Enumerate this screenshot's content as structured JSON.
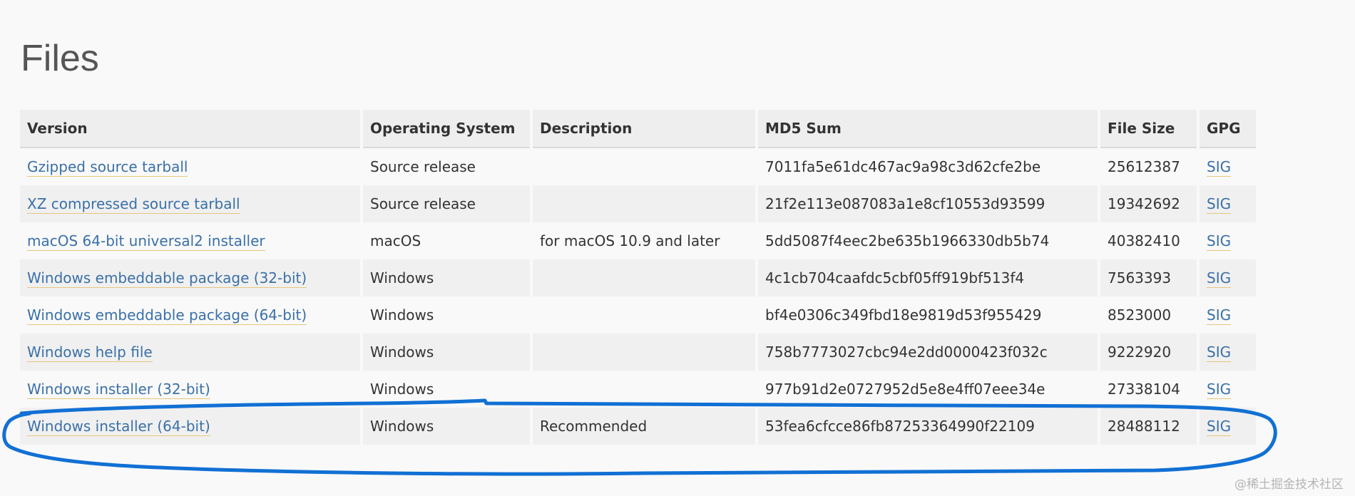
{
  "page": {
    "heading": "Files",
    "watermark": "@稀土掘金技术社区"
  },
  "table": {
    "headers": {
      "version": "Version",
      "os": "Operating System",
      "description": "Description",
      "md5": "MD5 Sum",
      "size": "File Size",
      "gpg": "GPG"
    },
    "rows": [
      {
        "version": "Gzipped source tarball",
        "os": "Source release",
        "description": "",
        "md5": "7011fa5e61dc467ac9a98c3d62cfe2be",
        "size": "25612387",
        "gpg": "SIG"
      },
      {
        "version": "XZ compressed source tarball",
        "os": "Source release",
        "description": "",
        "md5": "21f2e113e087083a1e8cf10553d93599",
        "size": "19342692",
        "gpg": "SIG"
      },
      {
        "version": "macOS 64-bit universal2 installer",
        "os": "macOS",
        "description": "for macOS 10.9 and later",
        "md5": "5dd5087f4eec2be635b1966330db5b74",
        "size": "40382410",
        "gpg": "SIG"
      },
      {
        "version": "Windows embeddable package (32-bit)",
        "os": "Windows",
        "description": "",
        "md5": "4c1cb704caafdc5cbf05ff919bf513f4",
        "size": "7563393",
        "gpg": "SIG"
      },
      {
        "version": "Windows embeddable package (64-bit)",
        "os": "Windows",
        "description": "",
        "md5": "bf4e0306c349fbd18e9819d53f955429",
        "size": "8523000",
        "gpg": "SIG"
      },
      {
        "version": "Windows help file",
        "os": "Windows",
        "description": "",
        "md5": "758b7773027cbc94e2dd0000423f032c",
        "size": "9222920",
        "gpg": "SIG"
      },
      {
        "version": "Windows installer (32-bit)",
        "os": "Windows",
        "description": "",
        "md5": "977b91d2e0727952d5e8e4ff07eee34e",
        "size": "27338104",
        "gpg": "SIG"
      },
      {
        "version": "Windows installer (64-bit)",
        "os": "Windows",
        "description": "Recommended",
        "md5": "53fea6cfcce86fb87253364990f22109",
        "size": "28488112",
        "gpg": "SIG"
      }
    ]
  },
  "colors": {
    "link": "#3a70a8",
    "link_underline": "#e6c67a",
    "annotation": "#1170d4"
  }
}
